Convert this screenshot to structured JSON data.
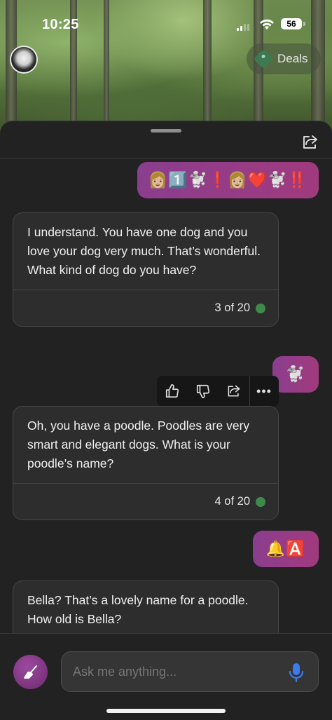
{
  "status_bar": {
    "time": "10:25",
    "battery": "56"
  },
  "header": {
    "deals_label": "Deals"
  },
  "messages": {
    "user1": "👩🏼1️⃣🐩❗👩🏼❤️🐩‼️",
    "bot1": {
      "text": "I understand. You have one dog and you love your dog very much. That’s wonderful. What kind of dog do you have?",
      "counter": "3 of 20"
    },
    "user2": "🐩",
    "bot2": {
      "text": "Oh, you have a poodle. Poodles are very smart and elegant dogs. What is your poodle’s name?",
      "counter": "4 of 20"
    },
    "user3": "🔔🅰️",
    "bot3": {
      "text": "Bella? That’s a lovely name for a poodle. How old is Bella?"
    }
  },
  "composer": {
    "placeholder": "Ask me anything..."
  },
  "colors": {
    "accent": "#9b3f8e",
    "status_ok": "#3f8a4a",
    "mic": "#3b7bf0"
  },
  "icons": [
    "avatar-image",
    "deals-tag-icon",
    "share-icon",
    "thumbs-up-icon",
    "thumbs-down-icon",
    "more-icon",
    "broom-icon",
    "microphone-icon"
  ]
}
